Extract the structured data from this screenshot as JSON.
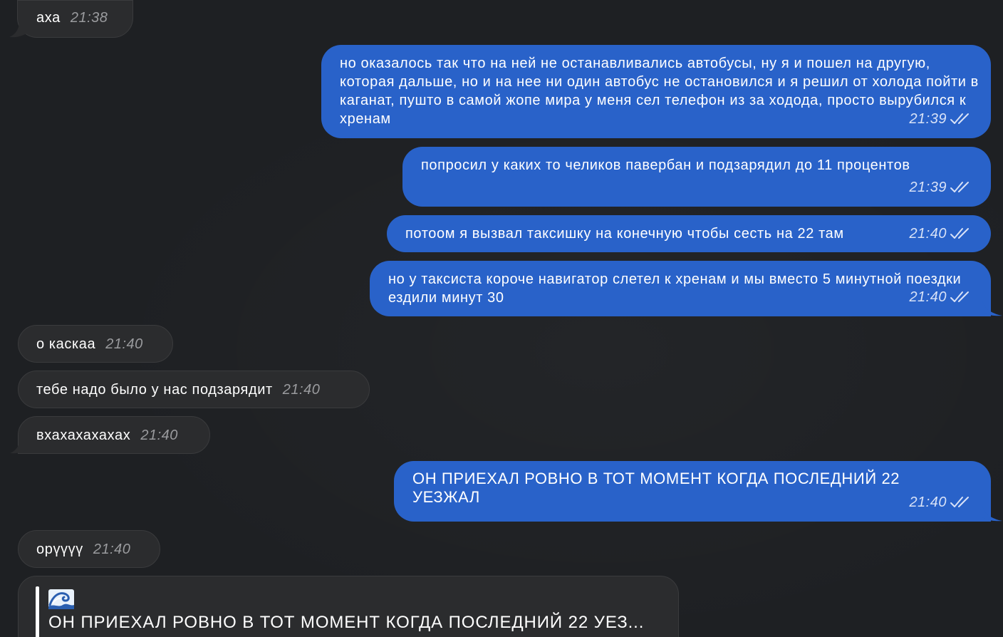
{
  "messages": [
    {
      "text": "аха",
      "time": "21:38"
    },
    {
      "text": "но оказалось так что на ней не останавливались автобусы, ну я и пошел на другую, которая дальше, но и на нее ни один автобус не остановился и я решил от холода пойти в каганат, пушто в самой жопе мира у меня сел телефон из за ходода, просто вырубился к хренам",
      "time": "21:39"
    },
    {
      "text": "попросил у каких то челиков павербан и подзарядил до 11 процентов",
      "time": "21:39"
    },
    {
      "text": "потоом я вызвал таксишку на конечную чтобы сесть на 22 там",
      "time": "21:40"
    },
    {
      "text": "но у таксиста короче навигатор слетел к хренам и мы вместо 5 минутной поездки ездили минут 30",
      "time": "21:40"
    },
    {
      "text": "о каскаа",
      "time": "21:40"
    },
    {
      "text": "тебе надо было у нас подзарядит",
      "time": "21:40"
    },
    {
      "text": "вхахахахахах",
      "time": "21:40"
    },
    {
      "text": "ОН ПРИЕХАЛ РОВНО В ТОТ МОМЕНТ КОГДА ПОСЛЕДНИЙ 22 УЕЗЖАЛ",
      "time": "21:40"
    },
    {
      "text": "орүүүү",
      "time": "21:40"
    }
  ],
  "reply_quote": {
    "icon": "wave-emoji-icon",
    "text": "ОН ПРИЕХАЛ РОВНО В ТОТ МОМЕНТ КОГДА ПОСЛЕДНИЙ 22 УЕЗ..."
  },
  "colors": {
    "background": "#1e2023",
    "incoming_bubble": "#2b2c2e",
    "outgoing_bubble": "#2962c9"
  }
}
